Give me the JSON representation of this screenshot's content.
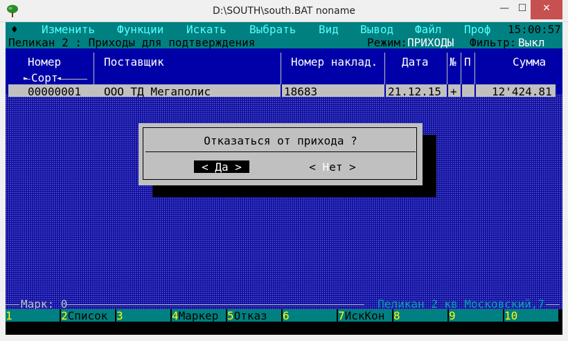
{
  "window": {
    "title": "D:\\SOUTH\\south.BAT noname",
    "minimize_glyph": "—",
    "maximize_glyph": "☐",
    "close_glyph": "✕"
  },
  "menu": {
    "arrow": "♦",
    "items": [
      "Изменить",
      "Функции",
      "Искать",
      "Выбрать",
      "Вид",
      "Вывод",
      "Файл",
      "Проф"
    ],
    "clock": "15:00:57"
  },
  "status": {
    "title": "Пеликан 2 : Приходы для подтверждения",
    "mode_label": "Режим:",
    "mode_value": "ПРИХОДЫ",
    "filter_label": "Фильтр:",
    "filter_value": "Выкл"
  },
  "table": {
    "columns": [
      "Номер",
      "Поставщик",
      "Номер наклад.",
      "Дата",
      "№",
      "П",
      "Сумма"
    ],
    "sort_label": "Сорт",
    "rows": [
      {
        "number": "00000001",
        "supplier": "ООО ТД Мегаполис",
        "invoice": "18683",
        "date": "21.12.15",
        "no": "+",
        "p": "",
        "sum": "12'424.81"
      }
    ]
  },
  "dialog": {
    "question": "Отказаться от прихода ?",
    "yes": "< Да >",
    "no_left": "< ",
    "no_hot": "Н",
    "no_rest": "ет >"
  },
  "footer": {
    "mark_label": "Марк: 0",
    "address": "Пеликан 2 кв Московский,7"
  },
  "fkeys": [
    {
      "num": "1",
      "label": ""
    },
    {
      "num": "2",
      "label": "Список"
    },
    {
      "num": "3",
      "label": ""
    },
    {
      "num": "4",
      "label": "Маркер"
    },
    {
      "num": "5",
      "label": "Отказ"
    },
    {
      "num": "6",
      "label": ""
    },
    {
      "num": "7",
      "label": "ИскКон"
    },
    {
      "num": "8",
      "label": ""
    },
    {
      "num": "9",
      "label": ""
    },
    {
      "num": "10",
      "label": ""
    }
  ]
}
